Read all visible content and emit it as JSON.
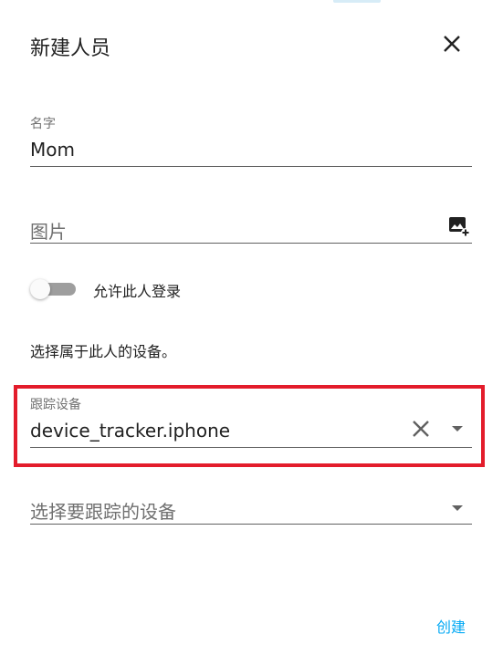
{
  "dialog": {
    "title": "新建人员",
    "close_icon": "close-icon"
  },
  "name_field": {
    "label": "名字",
    "value": "Mom"
  },
  "picture_field": {
    "placeholder": "图片",
    "icon": "add-photo-icon"
  },
  "login_toggle": {
    "label": "允许此人登录",
    "checked": false
  },
  "devices": {
    "description": "选择属于此人的设备。",
    "tracker_field": {
      "label": "跟踪设备",
      "value": "device_tracker.iphone",
      "clear_icon": "clear-icon",
      "dropdown_icon": "dropdown-arrow-icon"
    },
    "add_device_field": {
      "placeholder": "选择要跟踪的设备",
      "dropdown_icon": "dropdown-arrow-icon"
    }
  },
  "actions": {
    "create_label": "创建"
  },
  "colors": {
    "accent": "#03a9f4",
    "highlight": "#e31c2b",
    "text": "#212121",
    "secondary_text": "#707070"
  }
}
